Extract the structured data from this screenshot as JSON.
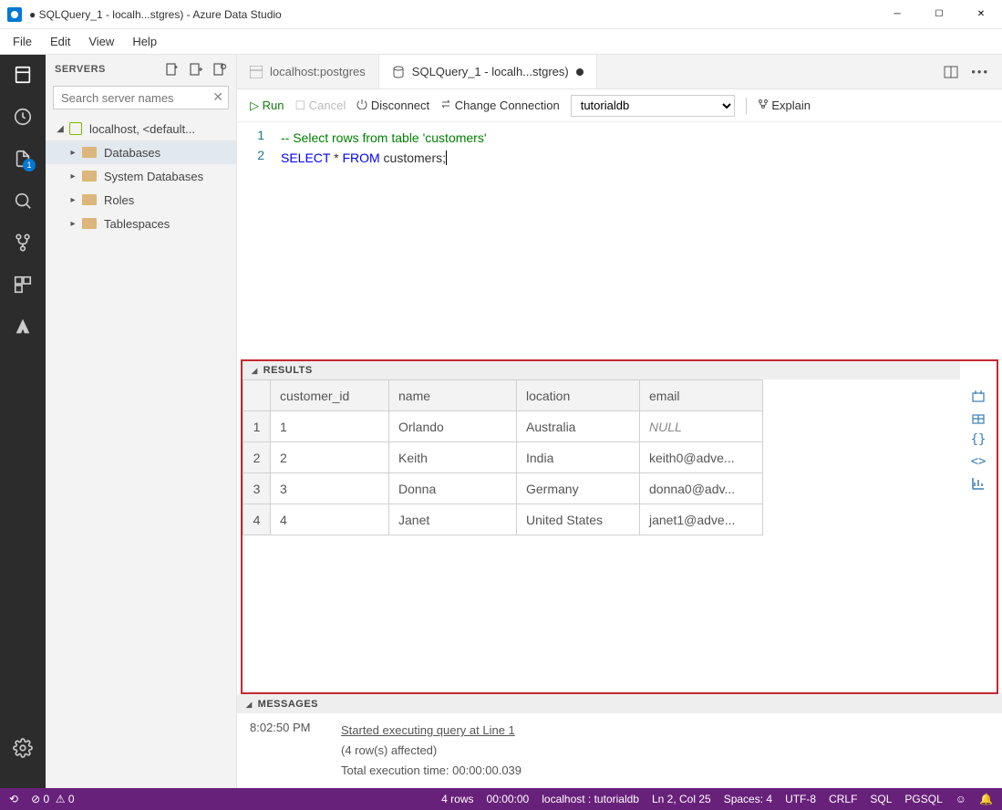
{
  "window": {
    "title": "● SQLQuery_1 - localh...stgres) - Azure Data Studio"
  },
  "menu": {
    "file": "File",
    "edit": "Edit",
    "view": "View",
    "help": "Help"
  },
  "activity": {
    "badge1": "1"
  },
  "sidebar": {
    "title": "SERVERS",
    "search_placeholder": "Search server names",
    "root": "localhost, <default...",
    "items": {
      "databases": "Databases",
      "sysdb": "System Databases",
      "roles": "Roles",
      "tablespaces": "Tablespaces"
    }
  },
  "tabs": {
    "tab1": "localhost:postgres",
    "tab2": "SQLQuery_1 - localh...stgres)"
  },
  "toolbar": {
    "run": "Run",
    "cancel": "Cancel",
    "disconnect": "Disconnect",
    "change": "Change Connection",
    "db": "tutorialdb",
    "explain": "Explain"
  },
  "editor": {
    "line1_num": "1",
    "line2_num": "2",
    "line1": "-- Select rows from table 'customers'",
    "line2_select": "SELECT",
    "line2_mid": " * ",
    "line2_from": "FROM",
    "line2_end": " customers;"
  },
  "results": {
    "header": "RESULTS",
    "cols": {
      "c1": "customer_id",
      "c2": "name",
      "c3": "location",
      "c4": "email"
    },
    "rows": [
      {
        "n": "1",
        "id": "1",
        "name": "Orlando",
        "loc": "Australia",
        "email": "NULL"
      },
      {
        "n": "2",
        "id": "2",
        "name": "Keith",
        "loc": "India",
        "email": "keith0@adve..."
      },
      {
        "n": "3",
        "id": "3",
        "name": "Donna",
        "loc": "Germany",
        "email": "donna0@adv..."
      },
      {
        "n": "4",
        "id": "4",
        "name": "Janet",
        "loc": "United States",
        "email": "janet1@adve..."
      }
    ]
  },
  "messages": {
    "header": "MESSAGES",
    "time": "8:02:50 PM",
    "m1": "Started executing query at Line 1",
    "m2": "(4 row(s) affected)",
    "m3": "Total execution time: 00:00:00.039"
  },
  "status": {
    "errs": "0",
    "warns": "0",
    "rows": "4 rows",
    "elapsed": "00:00:00",
    "conn": "localhost : tutorialdb",
    "pos": "Ln 2, Col 25",
    "spaces": "Spaces: 4",
    "enc": "UTF-8",
    "eol": "CRLF",
    "lang": "SQL",
    "db": "PGSQL"
  }
}
